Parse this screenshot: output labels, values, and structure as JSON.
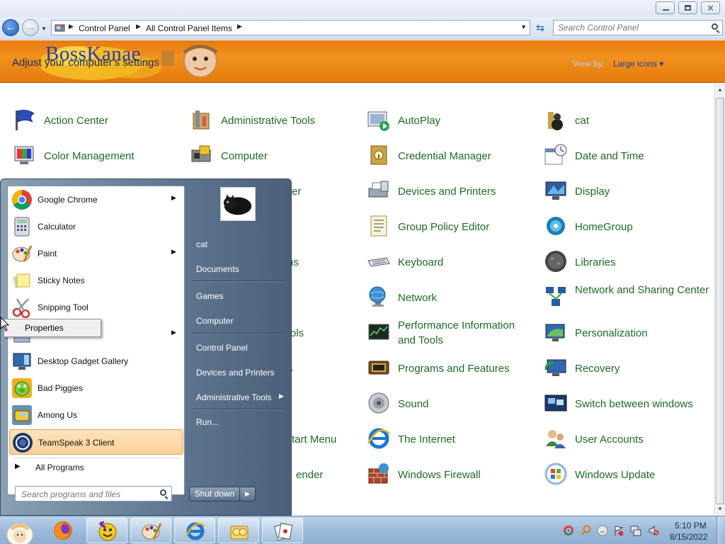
{
  "window": {
    "buttons": {
      "minimize": "minimize",
      "maximize": "restore",
      "close": "✕"
    }
  },
  "nav": {
    "back_icon": "←",
    "forward_icon": "→",
    "breadcrumbs": [
      "Control Panel",
      "All Control Panel Items"
    ],
    "search_placeholder": "Search Control Panel"
  },
  "banner": {
    "logo_text": "BossKanae",
    "title": "Adjust your computer's settings",
    "view_by_label": "View by:",
    "view_by_value": "Large icons ▾"
  },
  "cp_items": [
    {
      "label": "Action Center",
      "icon": "flag-icon"
    },
    {
      "label": "Administrative Tools",
      "icon": "admin-tools-icon"
    },
    {
      "label": "AutoPlay",
      "icon": "autoplay-icon"
    },
    {
      "label": "cat",
      "icon": "cat-icon"
    },
    {
      "label": "Color Management",
      "icon": "color-management-icon"
    },
    {
      "label": "Computer",
      "icon": "computer-icon"
    },
    {
      "label": "Credential Manager",
      "icon": "credential-manager-icon"
    },
    {
      "label": "Date and Time",
      "icon": "calendar-clock-icon"
    },
    {
      "label": "er",
      "icon": "hidden-icon"
    },
    {
      "label": "Devices and Printers",
      "icon": "printer-icon"
    },
    {
      "label": "Display",
      "icon": "display-icon"
    },
    {
      "label": "Group Policy Editor",
      "icon": "policy-scroll-icon"
    },
    {
      "label": "HomeGroup",
      "icon": "homegroup-icon"
    },
    {
      "label": "ns",
      "icon": "hidden-icon"
    },
    {
      "label": "Keyboard",
      "icon": "keyboard-icon"
    },
    {
      "label": "Libraries",
      "icon": "libraries-icon"
    },
    {
      "label": "Network",
      "icon": "network-globe-icon"
    },
    {
      "label": "Network and Sharing Center",
      "icon": "network-sharing-icon"
    },
    {
      "label": "ols",
      "icon": "hidden-icon"
    },
    {
      "label": "Performance Information and Tools",
      "icon": "performance-icon"
    },
    {
      "label": "Personalization",
      "icon": "personalization-icon"
    },
    {
      "label": "s",
      "icon": "hidden-icon"
    },
    {
      "label": "Programs and Features",
      "icon": "programs-features-icon"
    },
    {
      "label": "Recovery",
      "icon": "recovery-icon"
    },
    {
      "label": "Sound",
      "icon": "speaker-icon"
    },
    {
      "label": "Switch between windows",
      "icon": "switch-windows-icon"
    },
    {
      "label": "tart Menu",
      "icon": "hidden-icon"
    },
    {
      "label": "The Internet",
      "icon": "ie-icon"
    },
    {
      "label": "User Accounts",
      "icon": "user-accounts-icon"
    },
    {
      "label": "ender",
      "icon": "hidden-icon"
    },
    {
      "label": "Windows Firewall",
      "icon": "firewall-icon"
    },
    {
      "label": "Windows Update",
      "icon": "windows-update-icon"
    }
  ],
  "start_menu": {
    "programs": [
      {
        "label": "Google Chrome",
        "icon": "chrome-icon",
        "has_submenu": true
      },
      {
        "label": "Calculator",
        "icon": "calculator-icon",
        "has_submenu": false
      },
      {
        "label": "Paint",
        "icon": "paint-icon",
        "has_submenu": true
      },
      {
        "label": "Sticky Notes",
        "icon": "sticky-notes-icon",
        "has_submenu": false
      },
      {
        "label": "Snipping Tool",
        "icon": "scissors-icon",
        "has_submenu": false
      },
      {
        "label": "",
        "icon": "covered-program-icon",
        "has_submenu": true
      },
      {
        "label": "Desktop Gadget Gallery",
        "icon": "gadget-gallery-icon",
        "has_submenu": false
      },
      {
        "label": "Bad Piggies",
        "icon": "bad-piggies-icon",
        "has_submenu": false
      },
      {
        "label": "Among Us",
        "icon": "among-us-icon",
        "has_submenu": false
      },
      {
        "label": "TeamSpeak 3 Client",
        "icon": "teamspeak-icon",
        "has_submenu": false,
        "highlighted": true
      }
    ],
    "all_programs": "All Programs",
    "search_placeholder": "Search programs and files",
    "right_links": [
      {
        "label": "cat"
      },
      {
        "label": "Documents"
      },
      {
        "label": "Games"
      },
      {
        "label": "Computer"
      },
      {
        "label": "Control Panel"
      },
      {
        "label": "Devices and Printers"
      },
      {
        "label": "Administrative Tools",
        "has_submenu": true
      },
      {
        "label": "Run..."
      }
    ],
    "shutdown_label": "Shut down",
    "shutdown_arrow": "▶"
  },
  "context_menu": {
    "items": [
      "Properties"
    ]
  },
  "taskbar": {
    "pinned": [
      "firefox-icon",
      "yahoo-messenger-icon",
      "paint-icon",
      "ie-icon",
      "libraries-icon",
      "cards-icon"
    ],
    "tray": [
      "chrome-tray-icon",
      "search-tray-icon",
      "emoticon-tray-icon",
      "flag-tray-icon",
      "network-tray-icon",
      "volume-muted-icon"
    ],
    "time": "5:10 PM",
    "date": "8/15/2022"
  }
}
